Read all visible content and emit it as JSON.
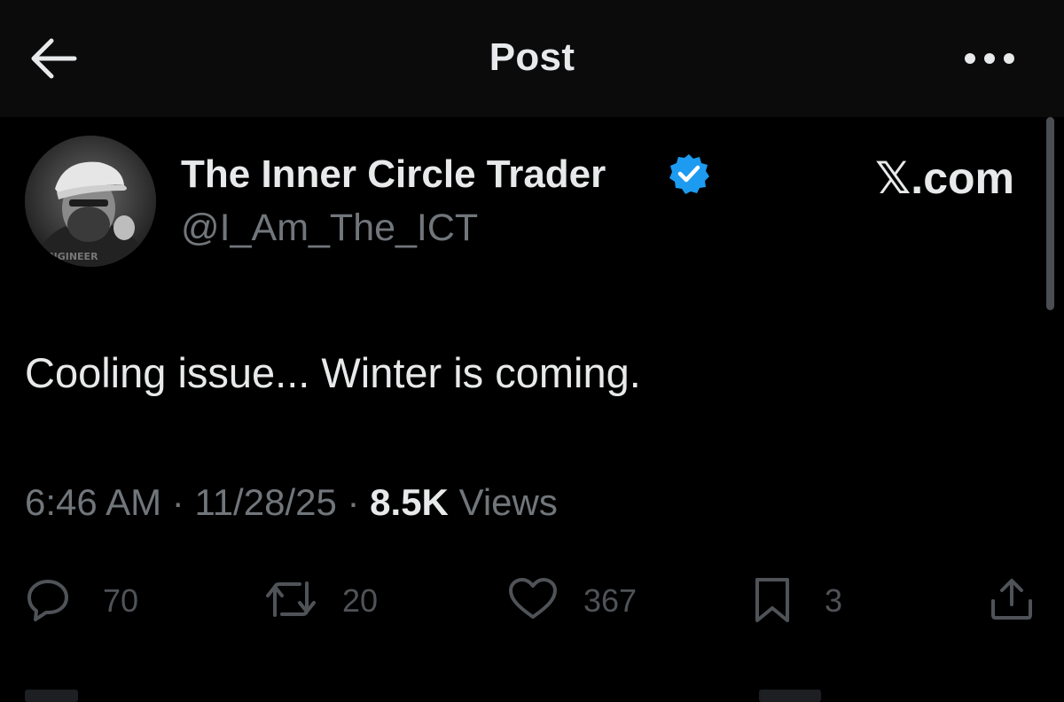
{
  "header": {
    "title": "Post"
  },
  "author": {
    "display_name": "The Inner Circle Trader",
    "handle": "@I_Am_The_ICT",
    "verified": true,
    "avatar_text": "ENGINEER"
  },
  "brand": "𝕏.com",
  "post": {
    "text": "Cooling issue... Winter is coming.",
    "time": "6:46 AM",
    "separator": "·",
    "date": "11/28/25",
    "views_count": "8.5K",
    "views_label": "Views"
  },
  "actions": {
    "replies": "70",
    "reposts": "20",
    "likes": "367",
    "bookmarks": "3"
  },
  "icons": {
    "back": "arrow-left-icon",
    "more": "more-horizontal-icon",
    "verified": "verified-badge-icon",
    "reply": "reply-icon",
    "repost": "repost-icon",
    "like": "heart-icon",
    "bookmark": "bookmark-icon",
    "share": "share-icon"
  },
  "colors": {
    "background": "#000000",
    "text": "#e7e9ea",
    "secondary": "#71767b",
    "verified": "#1d9bf0",
    "action": "#4f5357"
  }
}
